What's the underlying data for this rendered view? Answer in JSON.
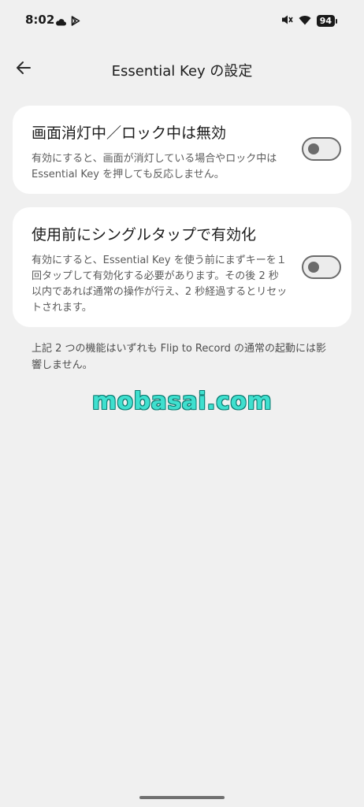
{
  "status_bar": {
    "time": "8:02",
    "battery": "94",
    "left_icons": [
      "cloud-icon",
      "play-store-icon"
    ],
    "right_icons": [
      "ringer-muted-icon",
      "wifi-icon",
      "battery-icon"
    ]
  },
  "app_bar": {
    "back_icon": "back-arrow-icon",
    "title": "Essential Key の設定"
  },
  "settings": [
    {
      "title": "画面消灯中／ロック中は無効",
      "description": "有効にすると、画面が消灯している場合やロック中は Essential Key を押しても反応しません。",
      "enabled": false
    },
    {
      "title": "使用前にシングルタップで有効化",
      "description": "有効にすると、Essential Key を使う前にまずキーを１回タップして有効化する必要があります。その後 2 秒以内であれば通常の操作が行え、2 秒経過するとリセットされます。",
      "enabled": false
    }
  ],
  "footnote": "上記 2 つの機能はいずれも Flip to Record の通常の起動には影響しません。",
  "watermark": "mobasai.com",
  "colors": {
    "background": "#f0f0f0",
    "card": "#ffffff",
    "toggle_off": "#6b6b6b",
    "watermark": "#3fe0cf"
  }
}
